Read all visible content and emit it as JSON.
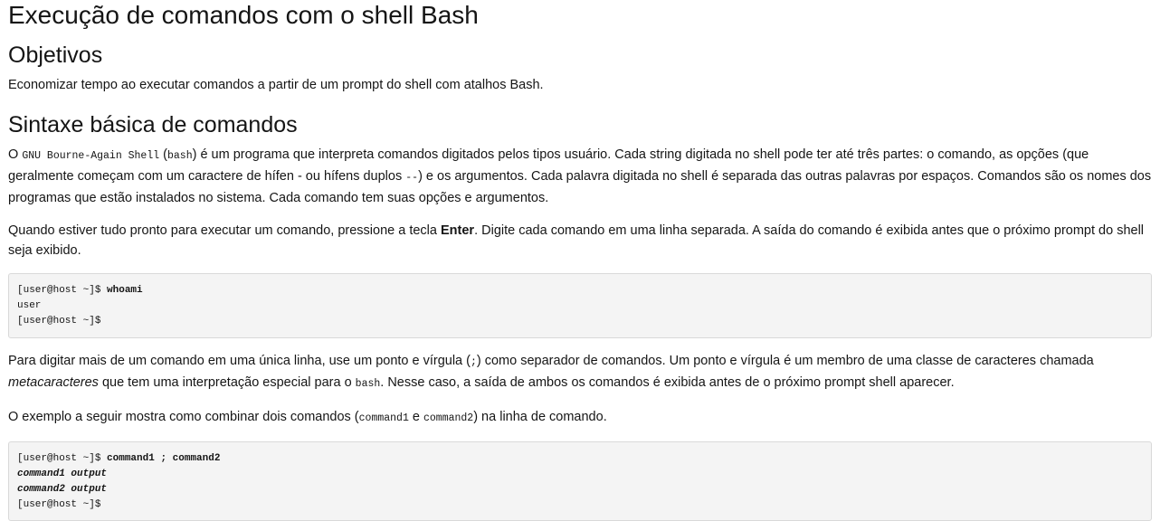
{
  "title": "Execução de comandos com o shell Bash",
  "objectives": {
    "heading": "Objetivos",
    "text": "Economizar tempo ao executar comandos a partir de um prompt do shell com atalhos Bash."
  },
  "syntax": {
    "heading": "Sintaxe básica de comandos",
    "p1": {
      "t1": "O ",
      "code1": "GNU Bourne-Again Shell",
      "t2": " (",
      "code2": "bash",
      "t3": ") é um programa que interpreta comandos digitados pelos tipos usuário. Cada string digitada no shell pode ter até três partes: o comando, as opções (que geralmente começam com um caractere de hífen - ou hífens duplos ",
      "code3": "--",
      "t4": ") e os argumentos. Cada palavra digitada no shell é separada das outras palavras por espaços. Comandos são os nomes dos programas que estão instalados no sistema. Cada comando tem suas opções e argumentos."
    },
    "p2": {
      "t1": "Quando estiver tudo pronto para executar um comando, pressione a tecla ",
      "key": "Enter",
      "t2": ". Digite cada comando em uma linha separada. A saída do comando é exibida antes que o próximo prompt do shell seja exibido."
    },
    "block1": {
      "prompt1": "[user@host ~]$ ",
      "cmd1": "whoami",
      "out1": "user",
      "prompt2": "[user@host ~]$"
    },
    "p3": {
      "t1": "Para digitar mais de um comando em uma única linha, use um ponto e vírgula (",
      "code1": ";",
      "t2": ") como separador de comandos. Um ponto e vírgula é um membro de uma classe de caracteres chamada ",
      "term": "metacaracteres",
      "t3": " que tem uma interpretação especial para o ",
      "code2": "bash",
      "t4": ". Nesse caso, a saída de ambos os comandos é exibida antes de o próximo prompt shell aparecer."
    },
    "p4": {
      "t1": "O exemplo a seguir mostra como combinar dois comandos (",
      "code1": "command1",
      "t2": " e ",
      "code2": "command2",
      "t3": ") na linha de comando."
    },
    "block2": {
      "prompt1": "[user@host ~]$ ",
      "cmd1": "command1 ; command2",
      "out1": "command1 output",
      "out2": "command2 output",
      "prompt2": "[user@host ~]$"
    }
  }
}
